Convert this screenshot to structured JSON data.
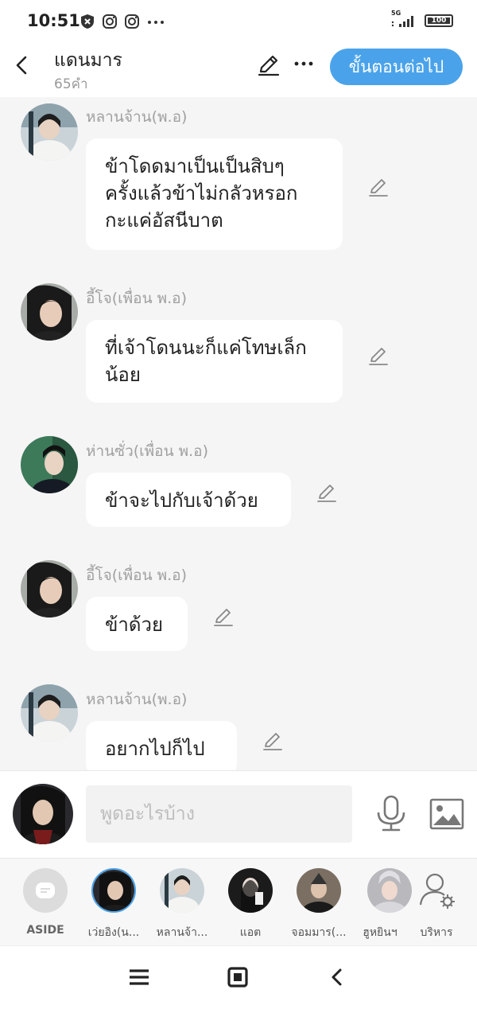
{
  "status_bar": {
    "time": "10:51",
    "network": "5G",
    "battery": "100"
  },
  "header": {
    "title": "แดนมาร",
    "subtitle": "65คำ",
    "next_button": "ขั้นตอนต่อไป"
  },
  "messages": [
    {
      "name": "หลานจ้าน(พ.อ)",
      "lines": [
        "ข้าโดดมาเป็นเป็นสิบๆ",
        "ครั้งแล้วข้าไม่กลัวหรอก",
        "กะแค่อัสนีบาต"
      ]
    },
    {
      "name": "อี้โจ(เพื่อน พ.อ)",
      "lines": [
        "ที่เจ้าโดนนะก็แค่โทษเล็ก",
        "น้อย"
      ]
    },
    {
      "name": "ห่านซั่ว(เพื่อน พ.อ)",
      "lines": [
        "ข้าจะไปกับเจ้าด้วย"
      ]
    },
    {
      "name": "อี้โจ(เพื่อน พ.อ)",
      "lines": [
        "ข้าด้วย"
      ]
    },
    {
      "name": "หลานจ้าน(พ.อ)",
      "lines": [
        "อยากไปก็ไป"
      ]
    }
  ],
  "input": {
    "placeholder": "พูดอะไรบ้าง"
  },
  "characters": [
    {
      "label": "ASIDE"
    },
    {
      "label": "เว่ยอิง(น..."
    },
    {
      "label": "หลานจ้า..."
    },
    {
      "label": "แอต"
    },
    {
      "label": "จอมมาร(..."
    },
    {
      "label": "ฮูหยินฯ"
    },
    {
      "label": "บริหาร"
    }
  ],
  "colors": {
    "accent": "#4aa3ea",
    "background": "#f5f5f5",
    "bubble": "#ffffff"
  }
}
